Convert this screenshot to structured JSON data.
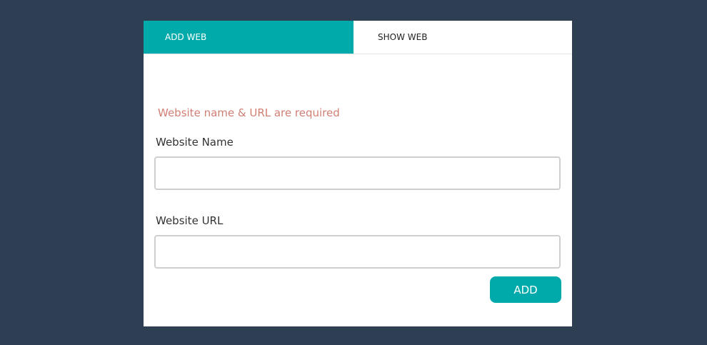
{
  "tabs": {
    "add_web": "ADD WEB",
    "show_web": "SHOW WEB"
  },
  "form": {
    "error_message": "Website name & URL are required",
    "website_name_label": "Website Name",
    "website_name_value": "",
    "website_url_label": "Website URL",
    "website_url_value": "",
    "add_button_label": "ADD"
  },
  "colors": {
    "accent": "#00aaaa",
    "background": "#2e3e53",
    "error": "#d07f75"
  }
}
